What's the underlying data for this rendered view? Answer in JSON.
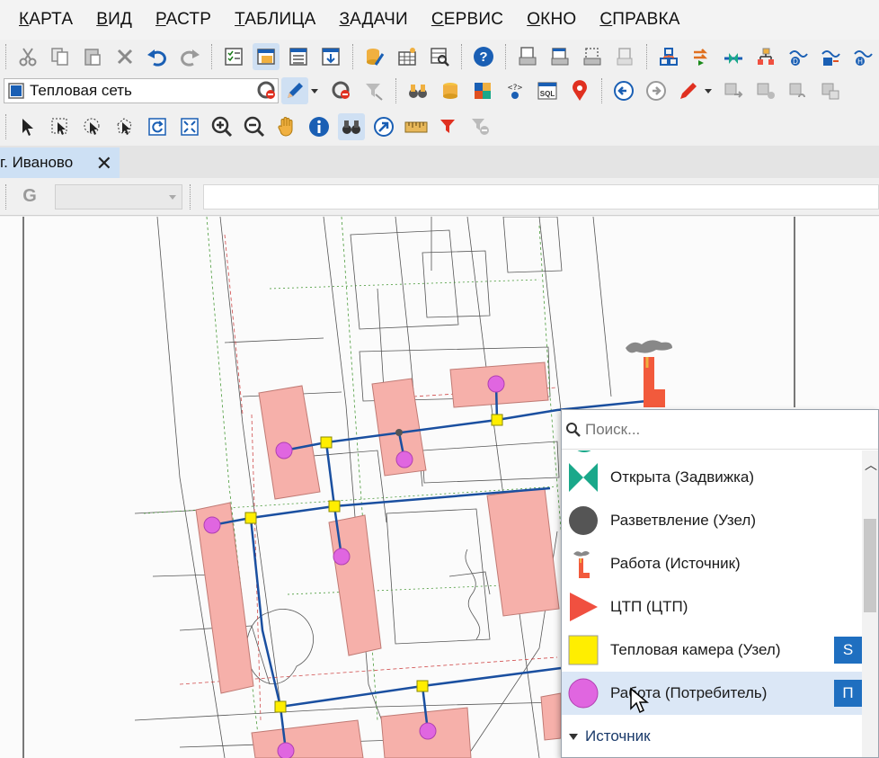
{
  "menu": {
    "items": [
      {
        "first": "К",
        "rest": "АРТА"
      },
      {
        "first": "В",
        "rest": "ИД"
      },
      {
        "first": "Р",
        "rest": "АСТР"
      },
      {
        "first": "Т",
        "rest": "АБЛИЦА"
      },
      {
        "first": "З",
        "rest": "АДАЧИ"
      },
      {
        "first": "С",
        "rest": "ЕРВИС"
      },
      {
        "first": "О",
        "rest": "КНО"
      },
      {
        "first": "С",
        "rest": "ПРАВКА"
      }
    ]
  },
  "toolbar": {
    "layer_select_value": "Тепловая сеть"
  },
  "document": {
    "tab_label": "г. Иваново",
    "close_symbol": "✕"
  },
  "formula_bar": {
    "g_letter": "G"
  },
  "map": {
    "building_color": "#f6b0aa",
    "pipe_color": "#1a4fa0",
    "consumer_color": "#e066e0",
    "chamber_color": "#ffee00"
  },
  "symbol_picker": {
    "search_placeholder": "Поиск...",
    "items": [
      {
        "label": "Открыта (Задвижка)",
        "icon": "valve-open-icon",
        "color": "#1aa88a"
      },
      {
        "label": "Разветвление (Узел)",
        "icon": "branch-node-icon",
        "color": "#555555"
      },
      {
        "label": "Работа (Источник)",
        "icon": "heat-source-icon",
        "color": "#f25a3c"
      },
      {
        "label": "ЦТП (ЦТП)",
        "icon": "ctp-triangle-icon",
        "color": "#f05040"
      },
      {
        "label": "Тепловая камера (Узел)",
        "icon": "heat-chamber-icon",
        "color": "#ffee00",
        "hotkey": "S"
      },
      {
        "label": "Работа (Потребитель)",
        "icon": "consumer-icon",
        "color": "#e066e0",
        "hotkey": "П"
      }
    ],
    "group_label": "Источник"
  }
}
